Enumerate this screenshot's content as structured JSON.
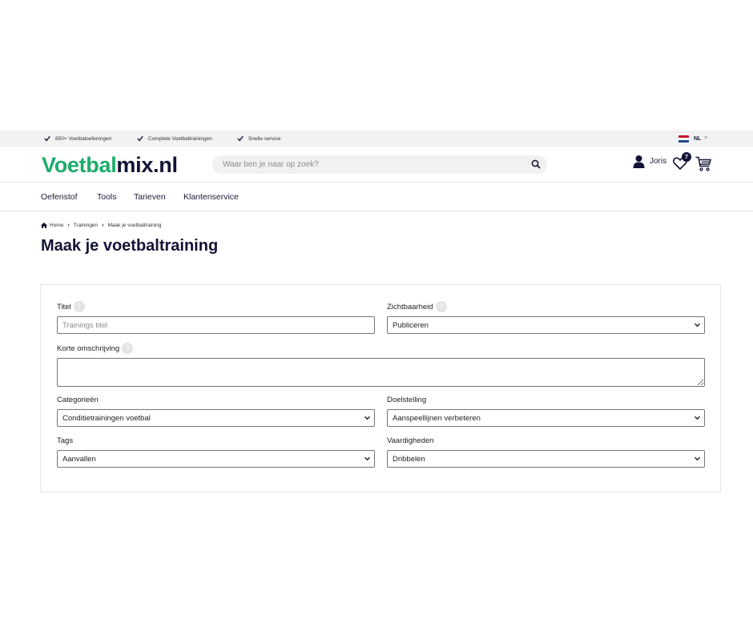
{
  "topbar": {
    "usps": [
      "850+ Voetbaloefeningen",
      "Complete Voetbaltrainingen",
      "Snelle service"
    ],
    "language": "NL"
  },
  "header": {
    "logo_part1": "Voetbal",
    "logo_part2": "mix.nl",
    "search_placeholder": "Waar ben je naar op zoek?",
    "user_name": "Joris",
    "wishlist_count": "7"
  },
  "nav": {
    "items": [
      "Oefenstof",
      "Tools",
      "Tarieven",
      "Klantenservice"
    ]
  },
  "breadcrumb": [
    "Home",
    "Trainingen",
    "Maak je voetbaltraining"
  ],
  "page_title": "Maak je voetbaltraining",
  "form": {
    "title_label": "Titel",
    "title_placeholder": "Trainings titel",
    "visibility_label": "Zichtbaarheid",
    "visibility_value": "Publiceren",
    "description_label": "Korte omschrijving",
    "categories_label": "Categorieën",
    "categories_value": "Conditietrainingen voetbal",
    "goal_label": "Doelstelling",
    "goal_value": "Aanspeellijnen verbeteren",
    "tags_label": "Tags",
    "tags_value": "Aanvallen",
    "skills_label": "Vaardigheden",
    "skills_value": "Dribbelen",
    "help_glyph": "?"
  },
  "colors": {
    "brand_green": "#1dac6c",
    "brand_navy": "#131336",
    "flag_red": "#c8102e",
    "flag_blue": "#21468b"
  }
}
